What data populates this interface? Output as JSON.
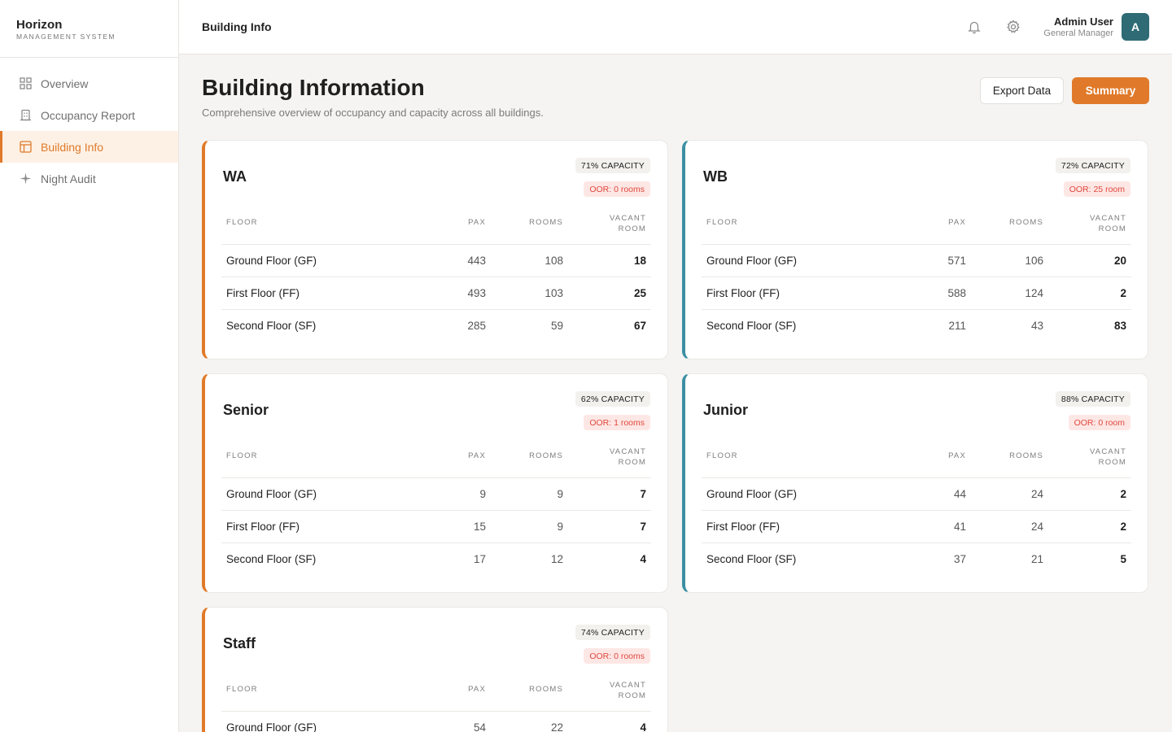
{
  "brand": {
    "name": "Horizon",
    "sub": "MANAGEMENT SYSTEM"
  },
  "nav": [
    {
      "label": "Overview",
      "icon": "grid-icon"
    },
    {
      "label": "Occupancy Report",
      "icon": "building-icon"
    },
    {
      "label": "Building Info",
      "icon": "layout-icon"
    },
    {
      "label": "Night Audit",
      "icon": "sparkle-icon"
    }
  ],
  "header": {
    "title": "Building Info"
  },
  "user": {
    "name": "Admin User",
    "role": "General Manager",
    "initial": "A"
  },
  "page": {
    "title": "Building Information",
    "subtitle": "Comprehensive overview of occupancy and capacity across all buildings.",
    "export_label": "Export Data",
    "summary_label": "Summary"
  },
  "colors": {
    "accent": "#e07a2a",
    "teal": "#3b8fa3",
    "avatar": "#2e6b74",
    "oor": "#e0483d"
  },
  "table_headers": {
    "floor": "FLOOR",
    "pax": "PAX",
    "rooms": "ROOMS",
    "vacant_1": "VACANT",
    "vacant_2": "ROOM"
  },
  "buildings": [
    {
      "name": "WA",
      "capacity": "71% CAPACITY",
      "oor": "OOR: 0 rooms",
      "rows": [
        {
          "floor": "Ground Floor (GF)",
          "pax": "443",
          "rooms": "108",
          "vacant": "18"
        },
        {
          "floor": "First Floor (FF)",
          "pax": "493",
          "rooms": "103",
          "vacant": "25"
        },
        {
          "floor": "Second Floor (SF)",
          "pax": "285",
          "rooms": "59",
          "vacant": "67"
        }
      ]
    },
    {
      "name": "WB",
      "capacity": "72% CAPACITY",
      "oor": "OOR: 25 room",
      "rows": [
        {
          "floor": "Ground Floor (GF)",
          "pax": "571",
          "rooms": "106",
          "vacant": "20"
        },
        {
          "floor": "First Floor (FF)",
          "pax": "588",
          "rooms": "124",
          "vacant": "2"
        },
        {
          "floor": "Second Floor (SF)",
          "pax": "211",
          "rooms": "43",
          "vacant": "83"
        }
      ]
    },
    {
      "name": "Senior",
      "capacity": "62% CAPACITY",
      "oor": "OOR: 1 rooms",
      "rows": [
        {
          "floor": "Ground Floor (GF)",
          "pax": "9",
          "rooms": "9",
          "vacant": "7"
        },
        {
          "floor": "First Floor (FF)",
          "pax": "15",
          "rooms": "9",
          "vacant": "7"
        },
        {
          "floor": "Second Floor (SF)",
          "pax": "17",
          "rooms": "12",
          "vacant": "4"
        }
      ]
    },
    {
      "name": "Junior",
      "capacity": "88% CAPACITY",
      "oor": "OOR: 0 room",
      "rows": [
        {
          "floor": "Ground Floor (GF)",
          "pax": "44",
          "rooms": "24",
          "vacant": "2"
        },
        {
          "floor": "First Floor (FF)",
          "pax": "41",
          "rooms": "24",
          "vacant": "2"
        },
        {
          "floor": "Second Floor (SF)",
          "pax": "37",
          "rooms": "21",
          "vacant": "5"
        }
      ]
    },
    {
      "name": "Staff",
      "capacity": "74% CAPACITY",
      "oor": "OOR: 0 rooms",
      "rows": [
        {
          "floor": "Ground Floor (GF)",
          "pax": "54",
          "rooms": "22",
          "vacant": "4"
        }
      ]
    }
  ]
}
